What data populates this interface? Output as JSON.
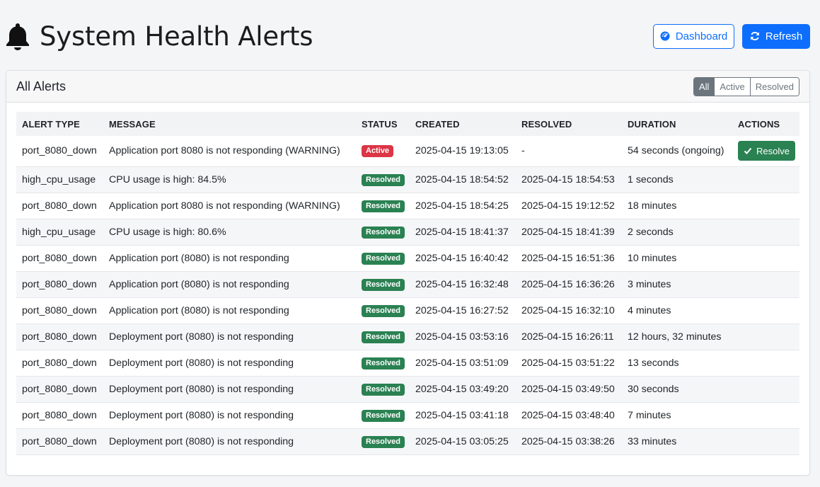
{
  "header": {
    "title": "System Health Alerts",
    "icon": "bell-icon",
    "dashboard_label": "Dashboard",
    "refresh_label": "Refresh"
  },
  "card": {
    "title": "All Alerts",
    "filters": [
      "All",
      "Active",
      "Resolved"
    ],
    "selected_filter": "All"
  },
  "table": {
    "columns": [
      "ALERT TYPE",
      "MESSAGE",
      "STATUS",
      "CREATED",
      "RESOLVED",
      "DURATION",
      "ACTIONS"
    ],
    "rows": [
      {
        "type": "port_8080_down",
        "message": "Application port 8080 is not responding (WARNING)",
        "status": "Active",
        "created": "2025-04-15 19:13:05",
        "resolved": "-",
        "duration": "54 seconds (ongoing)",
        "action": "Resolve"
      },
      {
        "type": "high_cpu_usage",
        "message": "CPU usage is high: 84.5%",
        "status": "Resolved",
        "created": "2025-04-15 18:54:52",
        "resolved": "2025-04-15 18:54:53",
        "duration": "1 seconds",
        "action": ""
      },
      {
        "type": "port_8080_down",
        "message": "Application port 8080 is not responding (WARNING)",
        "status": "Resolved",
        "created": "2025-04-15 18:54:25",
        "resolved": "2025-04-15 19:12:52",
        "duration": "18 minutes",
        "action": ""
      },
      {
        "type": "high_cpu_usage",
        "message": "CPU usage is high: 80.6%",
        "status": "Resolved",
        "created": "2025-04-15 18:41:37",
        "resolved": "2025-04-15 18:41:39",
        "duration": "2 seconds",
        "action": ""
      },
      {
        "type": "port_8080_down",
        "message": "Application port (8080) is not responding",
        "status": "Resolved",
        "created": "2025-04-15 16:40:42",
        "resolved": "2025-04-15 16:51:36",
        "duration": "10 minutes",
        "action": ""
      },
      {
        "type": "port_8080_down",
        "message": "Application port (8080) is not responding",
        "status": "Resolved",
        "created": "2025-04-15 16:32:48",
        "resolved": "2025-04-15 16:36:26",
        "duration": "3 minutes",
        "action": ""
      },
      {
        "type": "port_8080_down",
        "message": "Application port (8080) is not responding",
        "status": "Resolved",
        "created": "2025-04-15 16:27:52",
        "resolved": "2025-04-15 16:32:10",
        "duration": "4 minutes",
        "action": ""
      },
      {
        "type": "port_8080_down",
        "message": "Deployment port (8080) is not responding",
        "status": "Resolved",
        "created": "2025-04-15 03:53:16",
        "resolved": "2025-04-15 16:26:11",
        "duration": "12 hours, 32 minutes",
        "action": ""
      },
      {
        "type": "port_8080_down",
        "message": "Deployment port (8080) is not responding",
        "status": "Resolved",
        "created": "2025-04-15 03:51:09",
        "resolved": "2025-04-15 03:51:22",
        "duration": "13 seconds",
        "action": ""
      },
      {
        "type": "port_8080_down",
        "message": "Deployment port (8080) is not responding",
        "status": "Resolved",
        "created": "2025-04-15 03:49:20",
        "resolved": "2025-04-15 03:49:50",
        "duration": "30 seconds",
        "action": ""
      },
      {
        "type": "port_8080_down",
        "message": "Deployment port (8080) is not responding",
        "status": "Resolved",
        "created": "2025-04-15 03:41:18",
        "resolved": "2025-04-15 03:48:40",
        "duration": "7 minutes",
        "action": ""
      },
      {
        "type": "port_8080_down",
        "message": "Deployment port (8080) is not responding",
        "status": "Resolved",
        "created": "2025-04-15 03:05:25",
        "resolved": "2025-04-15 03:38:26",
        "duration": "33 minutes",
        "action": ""
      }
    ]
  },
  "colors": {
    "primary": "#0d6efd",
    "active_badge": "#dc3545",
    "resolved_badge": "#2a8152",
    "filter_selected": "#6c757d"
  }
}
